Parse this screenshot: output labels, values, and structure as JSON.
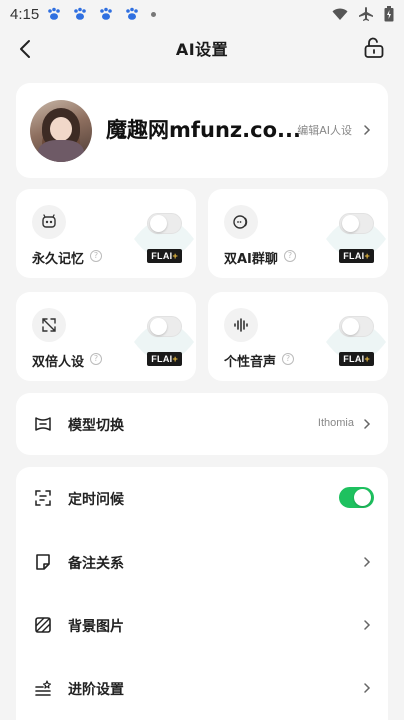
{
  "status_bar": {
    "time": "4:15"
  },
  "header": {
    "title": "AI设置"
  },
  "profile": {
    "name": "魔趣网mfunz.co...",
    "edit_label": "编辑AI人设"
  },
  "features": [
    {
      "label": "永久记忆",
      "badge": "FLAI",
      "enabled": false,
      "icon": "memory-icon"
    },
    {
      "label": "双AI群聊",
      "badge": "FLAI",
      "enabled": false,
      "icon": "chat-bubbles-icon"
    },
    {
      "label": "双倍人设",
      "badge": "FLAI",
      "enabled": false,
      "icon": "expand-icon"
    },
    {
      "label": "个性音声",
      "badge": "FLAI",
      "enabled": false,
      "icon": "voice-wave-icon"
    }
  ],
  "model": {
    "label": "模型切换",
    "value": "Ithomia"
  },
  "settings": {
    "scheduled_greeting": {
      "label": "定时问候",
      "enabled": true
    },
    "note_relation": {
      "label": "备注关系"
    },
    "background_image": {
      "label": "背景图片"
    },
    "advanced_settings": {
      "label": "进阶设置"
    }
  },
  "colors": {
    "accent_green": "#1ec15f",
    "status_icon_blue": "#2f6fe0"
  }
}
